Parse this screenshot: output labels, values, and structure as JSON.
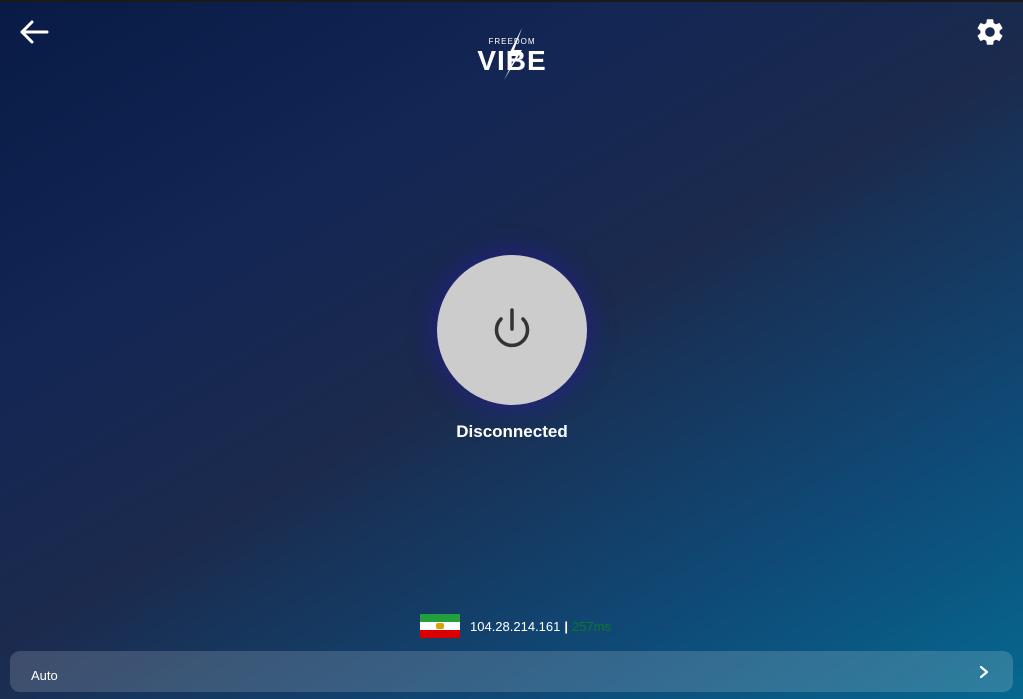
{
  "header": {
    "logo": {
      "small_text": "FREEDOM",
      "big_text": "VIBE"
    }
  },
  "connection": {
    "status": "Disconnected"
  },
  "server": {
    "flag": "iran-flag",
    "ip": "104.28.214.161",
    "separator": "|",
    "ping": "257ms"
  },
  "mode": {
    "label": "Auto"
  },
  "colors": {
    "power_button": "#cccccc",
    "ping_text": "#0b7a2a"
  },
  "icons": {
    "back": "arrow-left-icon",
    "settings": "gear-icon",
    "power": "power-icon",
    "chevron": "chevron-right-icon"
  }
}
